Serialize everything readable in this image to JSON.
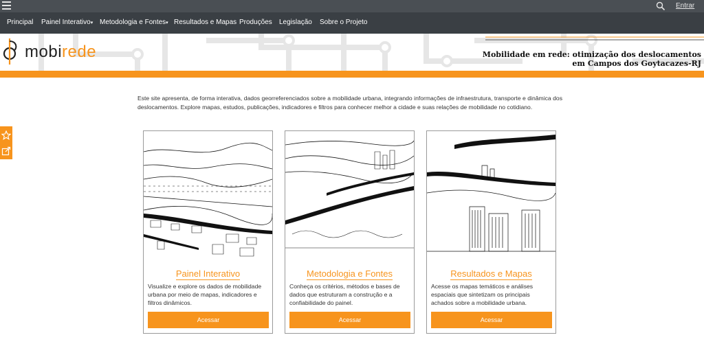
{
  "topbar": {
    "menu_icon": "hamburger-icon",
    "search_icon": "search-icon",
    "login_label": "Entrar"
  },
  "nav": {
    "items": [
      {
        "label": "Principal",
        "dropdown": false
      },
      {
        "label": "Painel Interativo",
        "dropdown": true
      },
      {
        "label": "Metodologia e Fontes",
        "dropdown": true
      },
      {
        "label": "Resultados e Mapas",
        "dropdown": false
      },
      {
        "label": "Produções",
        "dropdown": false
      },
      {
        "label": "Legislação",
        "dropdown": false
      },
      {
        "label": "Sobre o Projeto",
        "dropdown": false
      }
    ],
    "caret": "▾"
  },
  "header": {
    "logo_part1": "mobi",
    "logo_part2": "rede",
    "tagline_line1": "Mobilidade em rede: otimização dos deslocamentos",
    "tagline_line2": "em Campos dos Goytacazes-RJ"
  },
  "side": {
    "icons": [
      "star-icon",
      "share-icon"
    ]
  },
  "intro": "Este site apresenta, de forma interativa, dados georreferenciados sobre a mobilidade urbana, integrando informações de infraestrutura, transporte e dinâmica dos deslocamentos. Explore mapas, estudos, publicações, indicadores e filtros para conhecer melhor a cidade e suas relações de mobilidade no cotidiano.",
  "cards": [
    {
      "title": "Painel Interativo",
      "description": "Visualize e explore os dados de mobilidade urbana por meio de mapas, indicadores e filtros dinâmicos.",
      "button": "Acessar"
    },
    {
      "title": "Metodologia e Fontes",
      "description": "Conheça os critérios, métodos e bases de dados que estruturam a construção e a confiabilidade do painel.",
      "button": "Acessar"
    },
    {
      "title": "Resultados e Mapas",
      "description": "Acesse os mapas temáticos e análises espaciais que sintetizam os principais achados sobre a mobilidade urbana.",
      "button": "Acessar"
    }
  ],
  "colors": {
    "accent": "#f7941d",
    "topbar": "#4a4f54",
    "navbar": "#3a3f44"
  }
}
